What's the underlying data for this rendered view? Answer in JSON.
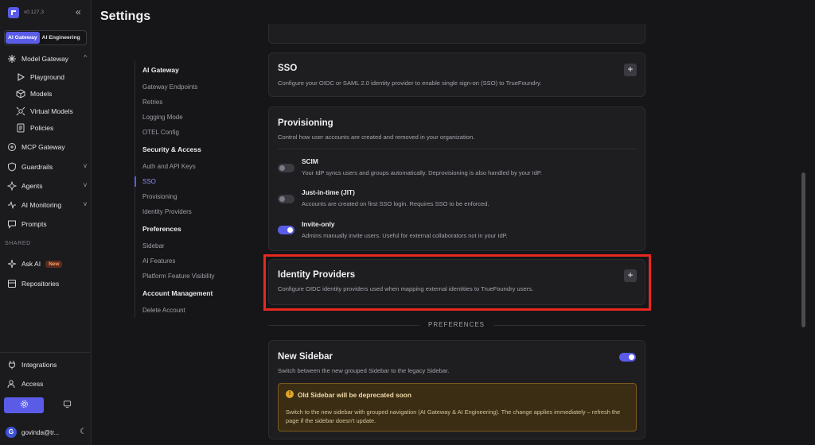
{
  "app": {
    "version": "v0.127.3"
  },
  "workspace_switch": {
    "options": [
      "AI Gateway",
      "AI Engineering"
    ],
    "selected": "AI Gateway"
  },
  "sidebar": {
    "items": [
      {
        "label": "Model Gateway",
        "icon": "model-gateway-icon"
      },
      {
        "label": "Playground",
        "icon": "play-icon"
      },
      {
        "label": "Models",
        "icon": "cube-icon"
      },
      {
        "label": "Virtual Models",
        "icon": "virtual-models-icon"
      },
      {
        "label": "Policies",
        "icon": "document-icon"
      },
      {
        "label": "MCP Gateway",
        "icon": "mcp-icon"
      },
      {
        "label": "Guardrails",
        "icon": "shield-icon"
      },
      {
        "label": "Agents",
        "icon": "agent-icon"
      },
      {
        "label": "AI Monitoring",
        "icon": "pulse-icon"
      },
      {
        "label": "Prompts",
        "icon": "chat-icon"
      }
    ],
    "shared_label": "SHARED",
    "shared_items": [
      {
        "label": "Ask AI",
        "badge": "New"
      },
      {
        "label": "Repositories"
      }
    ],
    "bottom_items": [
      {
        "label": "Integrations"
      },
      {
        "label": "Access"
      }
    ],
    "user": {
      "initial": "G",
      "name": "govinda@tr..."
    }
  },
  "page": {
    "title": "Settings"
  },
  "settings_nav": {
    "sections": [
      {
        "heading": "AI Gateway",
        "items": [
          "Gateway Endpoints",
          "Retries",
          "Logging Mode",
          "OTEL Config"
        ]
      },
      {
        "heading": "Security & Access",
        "items": [
          "Auth and API Keys",
          "SSO",
          "Provisioning",
          "Identity Providers"
        ]
      },
      {
        "heading": "Preferences",
        "items": [
          "Sidebar",
          "AI Features",
          "Platform Feature Visibility"
        ]
      },
      {
        "heading": "Account Management",
        "items": [
          "Delete Account"
        ]
      }
    ],
    "active": "SSO"
  },
  "sso": {
    "title": "SSO",
    "description": "Configure your OIDC or SAML 2.0 identity provider to enable single sign-on (SSO) to TrueFoundry.",
    "add_label": "+"
  },
  "provisioning": {
    "title": "Provisioning",
    "description": "Control how user accounts are created and removed in your organization.",
    "options": [
      {
        "title": "SCIM",
        "description": "Your IdP syncs users and groups automatically. Deprovisioning is also handled by your IdP.",
        "enabled": false
      },
      {
        "title": "Just-in-time (JIT)",
        "description": "Accounts are created on first SSO login. Requires SSO to be enforced.",
        "enabled": false
      },
      {
        "title": "Invite-only",
        "description": "Admins manually invite users. Useful for external collaborators not in your IdP.",
        "enabled": true
      }
    ]
  },
  "identity_providers": {
    "title": "Identity Providers",
    "description": "Configure OIDC identity providers used when mapping external identities to TrueFoundry users.",
    "add_label": "+"
  },
  "preferences_separator": "PREFERENCES",
  "new_sidebar": {
    "title": "New Sidebar",
    "description": "Switch between the new grouped Sidebar to the legacy Sidebar.",
    "enabled": true,
    "warning": {
      "title": "Old Sidebar will be deprecated soon",
      "text": "Switch to the new sidebar with grouped navigation (AI Gateway & AI Engineering). The change applies immediately – refresh the page if the sidebar doesn't update."
    }
  },
  "colors": {
    "accent": "#5a5ce8",
    "highlight": "#e8281e",
    "warning_bg": "#3a2d14"
  }
}
